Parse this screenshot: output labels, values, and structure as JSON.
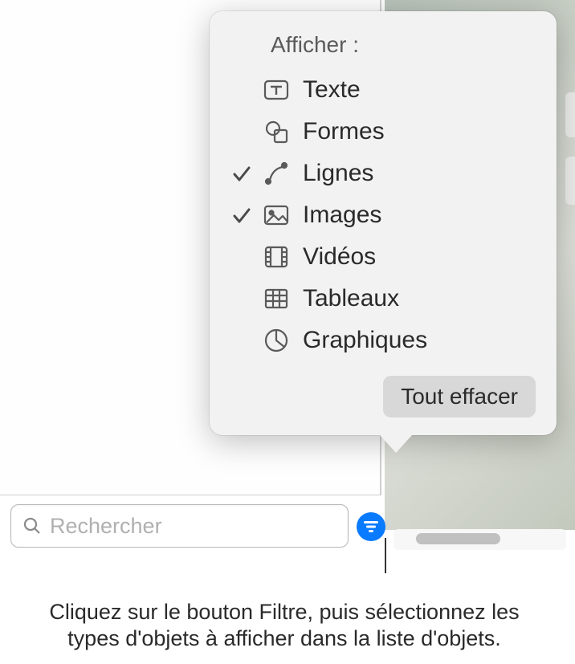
{
  "popover": {
    "header": "Afficher :",
    "items": [
      {
        "id": "text",
        "label": "Texte",
        "checked": false
      },
      {
        "id": "shapes",
        "label": "Formes",
        "checked": false
      },
      {
        "id": "lines",
        "label": "Lignes",
        "checked": true
      },
      {
        "id": "images",
        "label": "Images",
        "checked": true
      },
      {
        "id": "videos",
        "label": "Vidéos",
        "checked": false
      },
      {
        "id": "tables",
        "label": "Tableaux",
        "checked": false
      },
      {
        "id": "charts",
        "label": "Graphiques",
        "checked": false
      }
    ],
    "clear_label": "Tout effacer"
  },
  "search": {
    "placeholder": "Rechercher"
  },
  "caption": {
    "text": "Cliquez sur le bouton Filtre, puis sélectionnez les types d'objets à afficher dans la liste d'objets."
  },
  "colors": {
    "accent": "#0a7aff"
  }
}
